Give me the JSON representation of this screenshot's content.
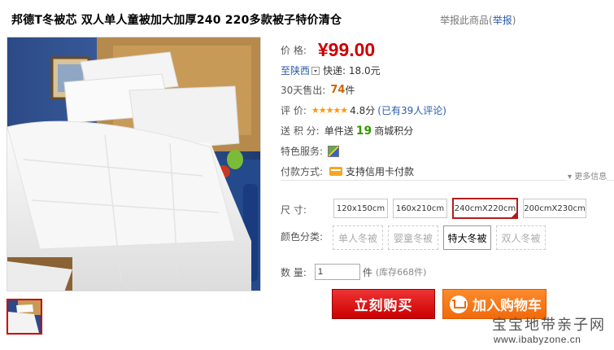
{
  "header": {
    "title": "邦德T冬被芯  双人单人童被加大加厚240  220多款被子特价清仓",
    "report_text": "举报此商品",
    "report_link": "举报"
  },
  "product": {
    "price_label": "价      格:",
    "price": "¥99.00",
    "ship_location": "至陕西",
    "ship_fee": "快递: 18.0元",
    "sold_label": "30天售出:",
    "sold_count": "74",
    "sold_unit": "件",
    "rating_label": "评      价:",
    "stars": "★★★★★",
    "rating_score": "4.8分",
    "rating_reviews": "(已有39人评论)",
    "points_label": "送  积  分:",
    "points_prefix": "单件送",
    "points_value": "19",
    "points_suffix": "商城积分",
    "service_label": "特色服务:",
    "payment_label": "付款方式:",
    "payment_text": "支持信用卡付款",
    "more_info": "▾ 更多信息"
  },
  "options": {
    "size_label": "尺      寸:",
    "sizes": [
      "120x150cm",
      "160x210cm",
      "240cmX220cm",
      "200cmX230cm"
    ],
    "selected_size": "240cmX220cm",
    "color_label": "颜色分类:",
    "colors": [
      "单人冬被",
      "婴童冬被",
      "特大冬被",
      "双人冬被"
    ],
    "selected_color": "特大冬被"
  },
  "quantity": {
    "label": "数      量:",
    "value": "1",
    "unit": "件",
    "stock": "(库存668件)"
  },
  "actions": {
    "buy_now": "立刻购买",
    "add_to_cart": "加入购物车"
  },
  "watermark": {
    "line1": "宝宝地带亲子网",
    "line2": "www.ibabyzone.cn"
  },
  "colors": {
    "price_red": "#cc0000",
    "link_blue": "#2a5caa",
    "buy_red": "#cc0000",
    "cart_orange": "#f26a0a"
  }
}
